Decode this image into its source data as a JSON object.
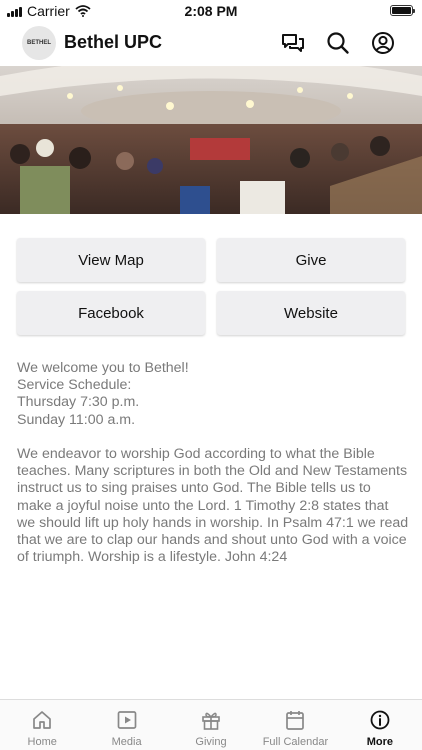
{
  "status_bar": {
    "carrier": "Carrier",
    "time": "2:08 PM",
    "battery_level": 1.0
  },
  "header": {
    "logo_text": "BETHEL",
    "title": "Bethel UPC",
    "icons": [
      "chat-icon",
      "search-icon",
      "account-icon"
    ]
  },
  "hero": {
    "icon": "congregation-photo"
  },
  "actions": {
    "view_map": "View Map",
    "give": "Give",
    "facebook": "Facebook",
    "website": "Website"
  },
  "description": "We welcome you to Bethel!\nService Schedule:\nThursday 7:30 p.m.\nSunday 11:00 a.m.\n\nWe endeavor to worship God according to what the Bible teaches. Many scriptures in both the Old and New Testaments instruct us to sing praises unto God. The Bible tells us to make a joyful noise unto the Lord. 1 Timothy 2:8 states that we should lift up holy hands in worship. In Psalm 47:1 we read that we are to clap our hands and shout unto God with a voice of triumph.  Worship is a lifestyle. John 4:24",
  "tab_bar": {
    "active": "More",
    "tabs": [
      {
        "label": "Home",
        "icon": "home-icon"
      },
      {
        "label": "Media",
        "icon": "media-icon"
      },
      {
        "label": "Giving",
        "icon": "gift-icon"
      },
      {
        "label": "Full Calendar",
        "icon": "calendar-icon"
      },
      {
        "label": "More",
        "icon": "info-icon"
      }
    ]
  },
  "colors": {
    "button_bg": "#efeff1",
    "body_text": "#7a7a7a",
    "inactive_tab": "#888888",
    "active_tab": "#111111"
  }
}
